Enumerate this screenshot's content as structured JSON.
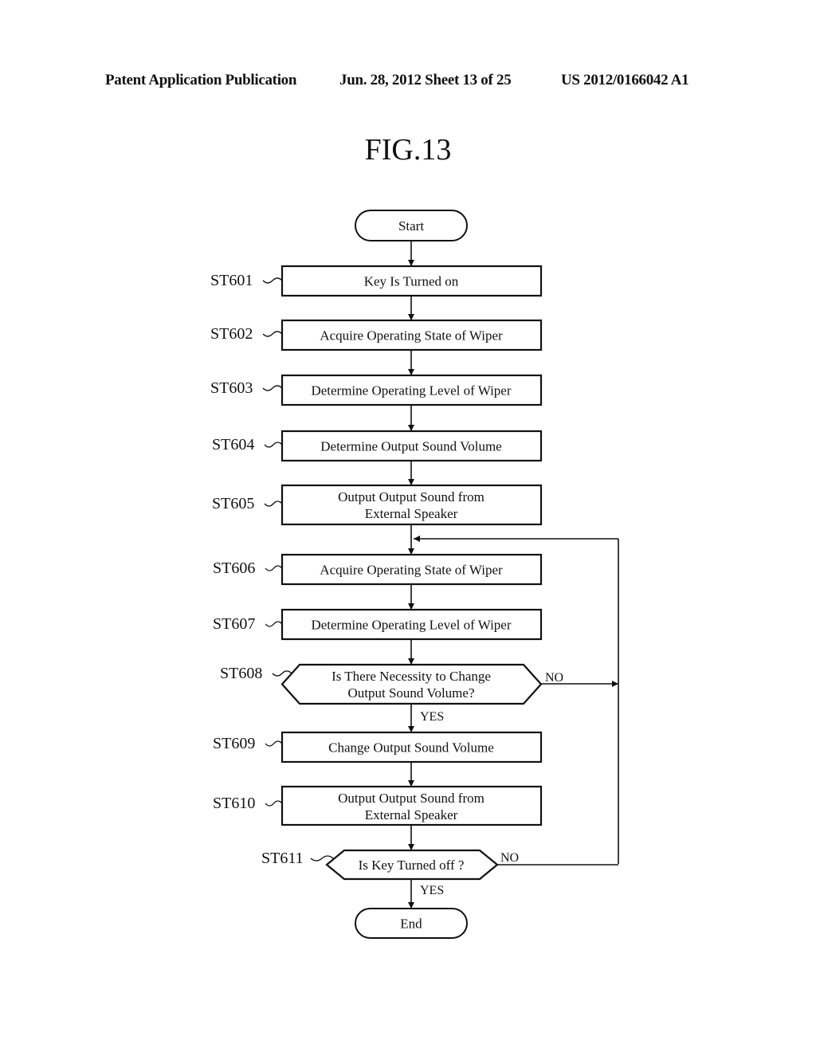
{
  "header": {
    "left": "Patent Application Publication",
    "middle": "Jun. 28, 2012  Sheet 13 of 25",
    "right": "US 2012/0166042 A1"
  },
  "figure": {
    "title": "FIG.13"
  },
  "flowchart": {
    "start": "Start",
    "end": "End",
    "steps": [
      {
        "id": "ST601",
        "type": "process",
        "lines": [
          "Key Is Turned on"
        ]
      },
      {
        "id": "ST602",
        "type": "process",
        "lines": [
          "Acquire Operating State of Wiper"
        ]
      },
      {
        "id": "ST603",
        "type": "process",
        "lines": [
          "Determine Operating Level of Wiper"
        ]
      },
      {
        "id": "ST604",
        "type": "process",
        "lines": [
          "Determine Output Sound Volume"
        ]
      },
      {
        "id": "ST605",
        "type": "process",
        "lines": [
          "Output Output Sound from",
          "External Speaker"
        ]
      },
      {
        "id": "ST606",
        "type": "process",
        "lines": [
          "Acquire Operating State of Wiper"
        ]
      },
      {
        "id": "ST607",
        "type": "process",
        "lines": [
          "Determine Operating Level of Wiper"
        ]
      },
      {
        "id": "ST608",
        "type": "decision",
        "lines": [
          "Is There Necessity to Change",
          "Output Sound Volume?"
        ],
        "yes": "YES",
        "no": "NO"
      },
      {
        "id": "ST609",
        "type": "process",
        "lines": [
          "Change Output Sound Volume"
        ]
      },
      {
        "id": "ST610",
        "type": "process",
        "lines": [
          "Output Output Sound from",
          "External Speaker"
        ]
      },
      {
        "id": "ST611",
        "type": "decision",
        "lines": [
          "Is Key Turned off ?"
        ],
        "yes": "YES",
        "no": "NO"
      }
    ]
  }
}
